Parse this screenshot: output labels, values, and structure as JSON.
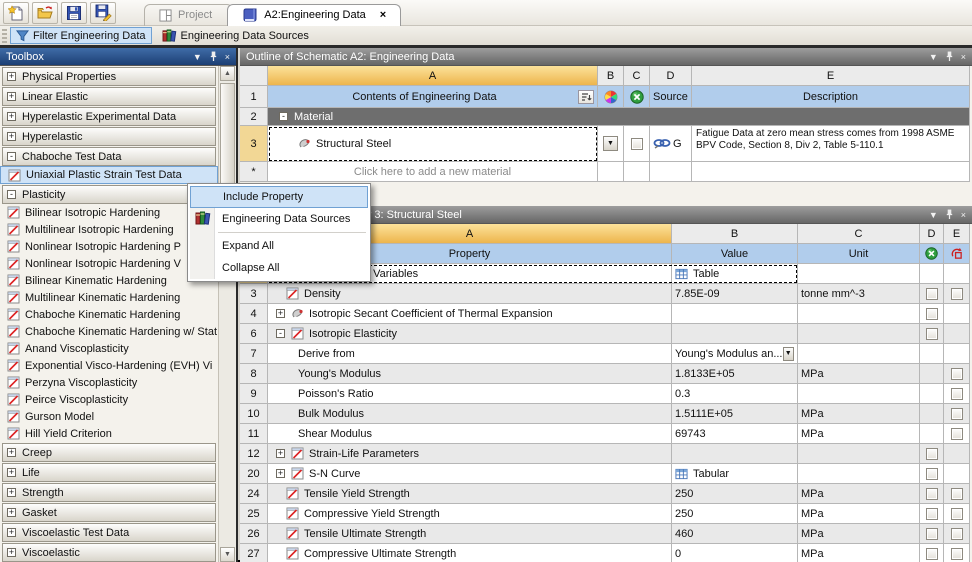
{
  "toolbar": {
    "icons": [
      {
        "name": "new-icon"
      },
      {
        "name": "open-icon"
      },
      {
        "name": "save-icon"
      },
      {
        "name": "save-as-icon"
      }
    ],
    "tabs": [
      {
        "label": "Project",
        "active": false
      },
      {
        "label": "A2:Engineering Data",
        "active": true,
        "close_glyph": "×"
      }
    ]
  },
  "ribbon": {
    "filter_button": "Filter Engineering Data",
    "sources_button": "Engineering Data Sources"
  },
  "panel_icons": {
    "menu": "▼",
    "pin": "-o",
    "close": "×"
  },
  "toolbox": {
    "title": "Toolbox",
    "entries": [
      {
        "kind": "cat",
        "expand": "+",
        "label": "Physical Properties"
      },
      {
        "kind": "cat",
        "expand": "+",
        "label": "Linear Elastic"
      },
      {
        "kind": "cat",
        "expand": "+",
        "label": "Hyperelastic Experimental Data"
      },
      {
        "kind": "cat",
        "expand": "+",
        "label": "Hyperelastic"
      },
      {
        "kind": "cat",
        "expand": "-",
        "label": "Chaboche Test Data"
      },
      {
        "kind": "item",
        "selected": true,
        "label": "Uniaxial Plastic Strain Test Data"
      },
      {
        "kind": "cat",
        "expand": "-",
        "label": "Plasticity"
      },
      {
        "kind": "item",
        "label": "Bilinear Isotropic Hardening"
      },
      {
        "kind": "item",
        "label": "Multilinear Isotropic Hardening"
      },
      {
        "kind": "item",
        "label": "Nonlinear Isotropic Hardening P"
      },
      {
        "kind": "item",
        "label": "Nonlinear Isotropic Hardening V"
      },
      {
        "kind": "item",
        "label": "Bilinear Kinematic Hardening"
      },
      {
        "kind": "item",
        "label": "Multilinear Kinematic Hardening"
      },
      {
        "kind": "item",
        "label": "Chaboche Kinematic Hardening"
      },
      {
        "kind": "item",
        "label": "Chaboche Kinematic Hardening w/ Stat"
      },
      {
        "kind": "item",
        "label": "Anand Viscoplasticity"
      },
      {
        "kind": "item",
        "label": "Exponential Visco-Hardening (EVH) Vi"
      },
      {
        "kind": "item",
        "label": "Perzyna Viscoplasticity"
      },
      {
        "kind": "item",
        "label": "Peirce Viscoplasticity"
      },
      {
        "kind": "item",
        "label": "Gurson Model"
      },
      {
        "kind": "item",
        "label": "Hill Yield Criterion"
      },
      {
        "kind": "cat",
        "expand": "+",
        "label": "Creep"
      },
      {
        "kind": "cat",
        "expand": "+",
        "label": "Life"
      },
      {
        "kind": "cat",
        "expand": "+",
        "label": "Strength"
      },
      {
        "kind": "cat",
        "expand": "+",
        "label": "Gasket"
      },
      {
        "kind": "cat",
        "expand": "+",
        "label": "Viscoelastic Test Data"
      },
      {
        "kind": "cat",
        "expand": "+",
        "label": "Viscoelastic"
      }
    ]
  },
  "context_menu": {
    "items": [
      {
        "label": "Include Property",
        "highlighted": true
      },
      {
        "label": "Engineering Data Sources",
        "icon": "books-icon"
      },
      {
        "label": "Expand All"
      },
      {
        "label": "Collapse All"
      }
    ]
  },
  "outline": {
    "title": "Outline of Schematic A2: Engineering Data",
    "col_headers": [
      "A",
      "B",
      "C",
      "D",
      "E"
    ],
    "header_row": {
      "num": "1",
      "a": "Contents of Engineering Data",
      "d": "Source",
      "e": "Description"
    },
    "group_row": {
      "num": "2",
      "expand": "-",
      "label": "Material"
    },
    "material_row": {
      "num": "3",
      "name": "Structural Steel",
      "source_text": "G",
      "description": "Fatigue Data at zero mean stress comes from 1998 ASME BPV Code, Section 8, Div 2, Table 5-110.1"
    },
    "add_row": {
      "num": "*",
      "placeholder": "Click here to add a new material"
    }
  },
  "properties": {
    "title": "Properties of Outline Row 3: Structural Steel",
    "col_headers": [
      "A",
      "B",
      "C",
      "D",
      "E"
    ],
    "header_row": {
      "a": "Property",
      "b": "Value",
      "c": "Unit"
    },
    "rows": [
      {
        "num": "2",
        "expand": "",
        "label": "Material Field Variables",
        "value": "Table",
        "unit": ""
      },
      {
        "num": "3",
        "expand": "",
        "label": "Density",
        "value": "7.85E-09",
        "unit": "tonne mm^-3"
      },
      {
        "num": "4",
        "expand": "+",
        "label": "Isotropic Secant Coefficient of Thermal Expansion",
        "value": "",
        "unit": ""
      },
      {
        "num": "6",
        "expand": "-",
        "label": "Isotropic Elasticity",
        "value": "",
        "unit": ""
      },
      {
        "num": "7",
        "expand": "",
        "label": "Derive from",
        "value": "Young's Modulus an...",
        "unit": ""
      },
      {
        "num": "8",
        "expand": "",
        "label": "Young's Modulus",
        "value": "1.8133E+05",
        "unit": "MPa"
      },
      {
        "num": "9",
        "expand": "",
        "label": "Poisson's Ratio",
        "value": "0.3",
        "unit": ""
      },
      {
        "num": "10",
        "expand": "",
        "label": "Bulk Modulus",
        "value": "1.5111E+05",
        "unit": "MPa"
      },
      {
        "num": "11",
        "expand": "",
        "label": "Shear Modulus",
        "value": "69743",
        "unit": "MPa"
      },
      {
        "num": "12",
        "expand": "+",
        "label": "Strain-Life Parameters",
        "value": "",
        "unit": ""
      },
      {
        "num": "20",
        "expand": "+",
        "label": "S-N Curve",
        "value": "Tabular",
        "unit": ""
      },
      {
        "num": "24",
        "expand": "",
        "label": "Tensile Yield Strength",
        "value": "250",
        "unit": "MPa"
      },
      {
        "num": "25",
        "expand": "",
        "label": "Compressive Yield Strength",
        "value": "250",
        "unit": "MPa"
      },
      {
        "num": "26",
        "expand": "",
        "label": "Tensile Ultimate Strength",
        "value": "460",
        "unit": "MPa"
      },
      {
        "num": "27",
        "expand": "",
        "label": "Compressive Ultimate Strength",
        "value": "0",
        "unit": "MPa"
      }
    ]
  },
  "colors": {
    "accent_blue": "#cfe3f7",
    "accent_border": "#70a1d3",
    "gold_header": "#edb54d",
    "blue_header_row": "#b1cdec",
    "group_gray": "#6e6e6e",
    "title_navy": "#1c3f74"
  }
}
